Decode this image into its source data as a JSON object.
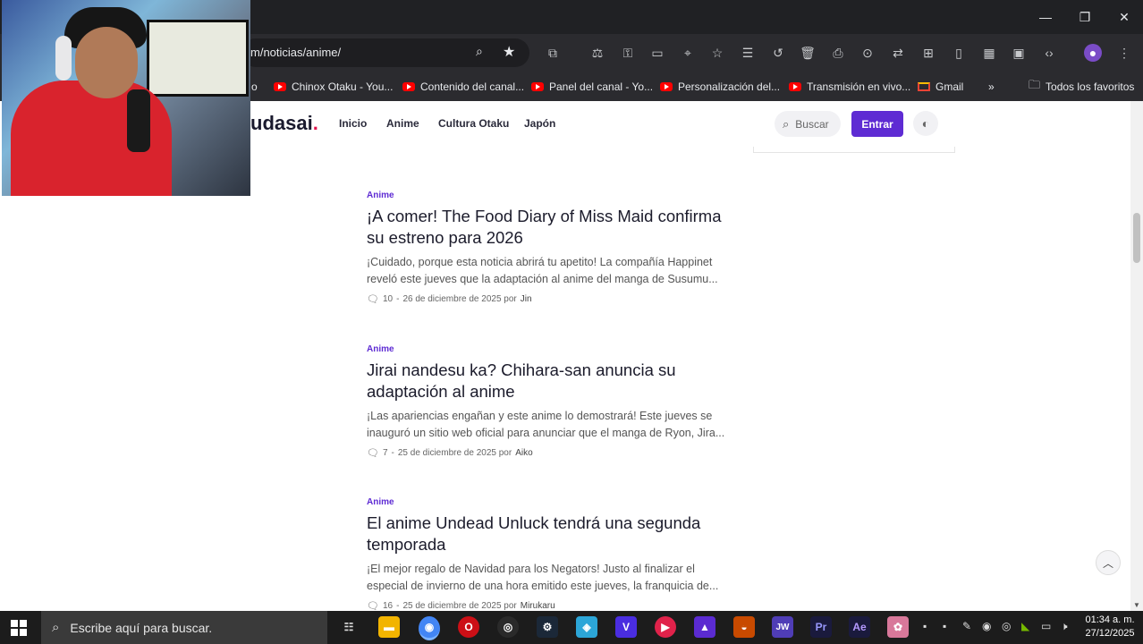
{
  "browser": {
    "url": "m/noticias/anime/",
    "bookmarks": [
      {
        "label": "o",
        "type": "yt"
      },
      {
        "label": "Chinox Otaku - You...",
        "type": "yt"
      },
      {
        "label": "Contenido del canal...",
        "type": "yt"
      },
      {
        "label": "Panel del canal - Yo...",
        "type": "yt"
      },
      {
        "label": "Personalización del...",
        "type": "yt"
      },
      {
        "label": "Transmisión en vivo...",
        "type": "yt"
      },
      {
        "label": "Gmail",
        "type": "gmail"
      }
    ],
    "more_bookmarks": "»",
    "all_favorites": "Todos los favoritos"
  },
  "site": {
    "logo": "udasai",
    "logo_dot": ".",
    "nav": [
      "Inicio",
      "Anime",
      "Cultura Otaku",
      "Japón"
    ],
    "search_label": "Buscar",
    "login_label": "Entrar"
  },
  "articles": [
    {
      "category": "Anime",
      "title": "¡A comer! The Food Diary of Miss Maid confirma su estreno para 2026",
      "excerpt": "¡Cuidado, porque esta noticia abrirá tu apetito! La compañía Happinet reveló este jueves que la adaptación al anime del manga de Susumu...",
      "comments": "10",
      "date": "26 de diciembre de 2025 por",
      "author": "Jin"
    },
    {
      "category": "Anime",
      "title": "Jirai nandesu ka? Chihara-san anuncia su adaptación al anime",
      "excerpt": "¡Las apariencias engañan y este anime lo demostrará! Este jueves se inauguró un sitio web oficial para anunciar que el manga de Ryon, Jira...",
      "comments": "7",
      "date": "25 de diciembre de 2025 por",
      "author": "Aiko"
    },
    {
      "category": "Anime",
      "title": "El anime Undead Unluck tendrá una segunda temporada",
      "excerpt": "¡El mejor regalo de Navidad para los Negators! Justo al finalizar el especial de invierno de una hora emitido este jueves, la franquicia de...",
      "comments": "16",
      "date": "25 de diciembre de 2025 por",
      "author": "Mirukaru"
    }
  ],
  "taskbar": {
    "search_placeholder": "Escribe aquí para buscar.",
    "time": "01:34 a. m.",
    "date": "27/12/2025"
  }
}
